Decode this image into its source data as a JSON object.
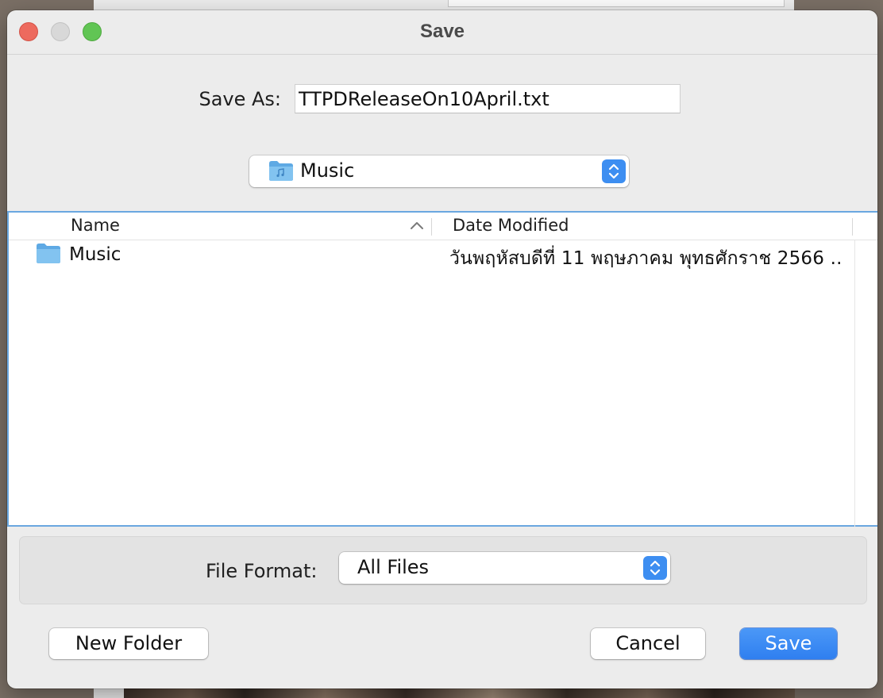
{
  "dialog": {
    "title": "Save",
    "save_as_label": "Save As:",
    "save_as_value": "TTPDReleaseOn10April.txt",
    "location": "Music"
  },
  "browser": {
    "columns": {
      "name": "Name",
      "date_modified": "Date Modified"
    },
    "sort": "name-ascending",
    "rows": [
      {
        "name": "Music",
        "date_modified": "วันพฤหัสบดีที่ 11 พฤษภาคม พุทธศักราช 2566 ..",
        "icon": "folder-icon"
      }
    ]
  },
  "format": {
    "label": "File Format:",
    "value": "All Files"
  },
  "buttons": {
    "new_folder": "New Folder",
    "cancel": "Cancel",
    "save": "Save"
  },
  "colors": {
    "accent": "#3d8ef1",
    "close": "#ed6a5e",
    "maximize": "#61c554",
    "selection_border": "#6aa7e0",
    "folder": "#6fb6ec"
  }
}
